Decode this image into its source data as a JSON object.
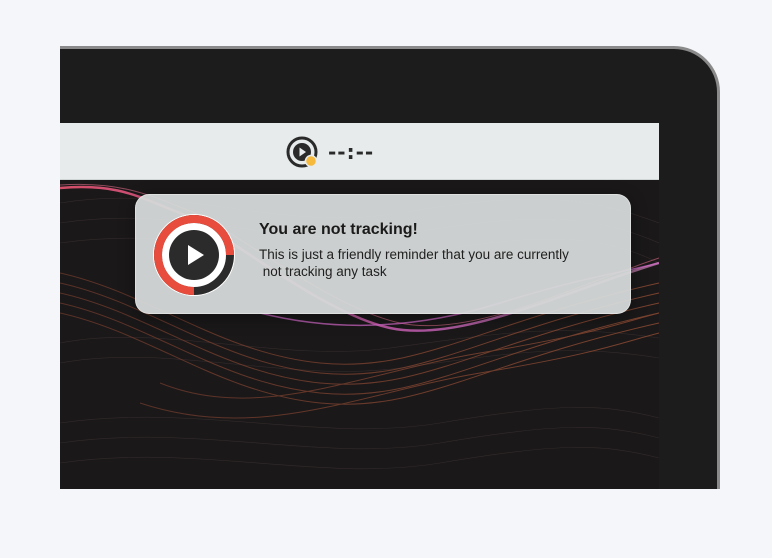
{
  "menubar": {
    "timer_display": "--:--",
    "tray_icon": "play-circle-icon",
    "status_dot_color": "#f6b93b"
  },
  "notification": {
    "title": "You are not tracking!",
    "body_line1": "This is just a friendly reminder that you are currently",
    "body_line2": " not tracking any task",
    "icon": "play-button-icon",
    "ring_color": "#e74c3c"
  },
  "colors": {
    "bezel": "#1c1c1c",
    "menubar": "#e7ebeb",
    "page_background": "#f4f6f9",
    "notification_background": "#d6d9d9"
  }
}
